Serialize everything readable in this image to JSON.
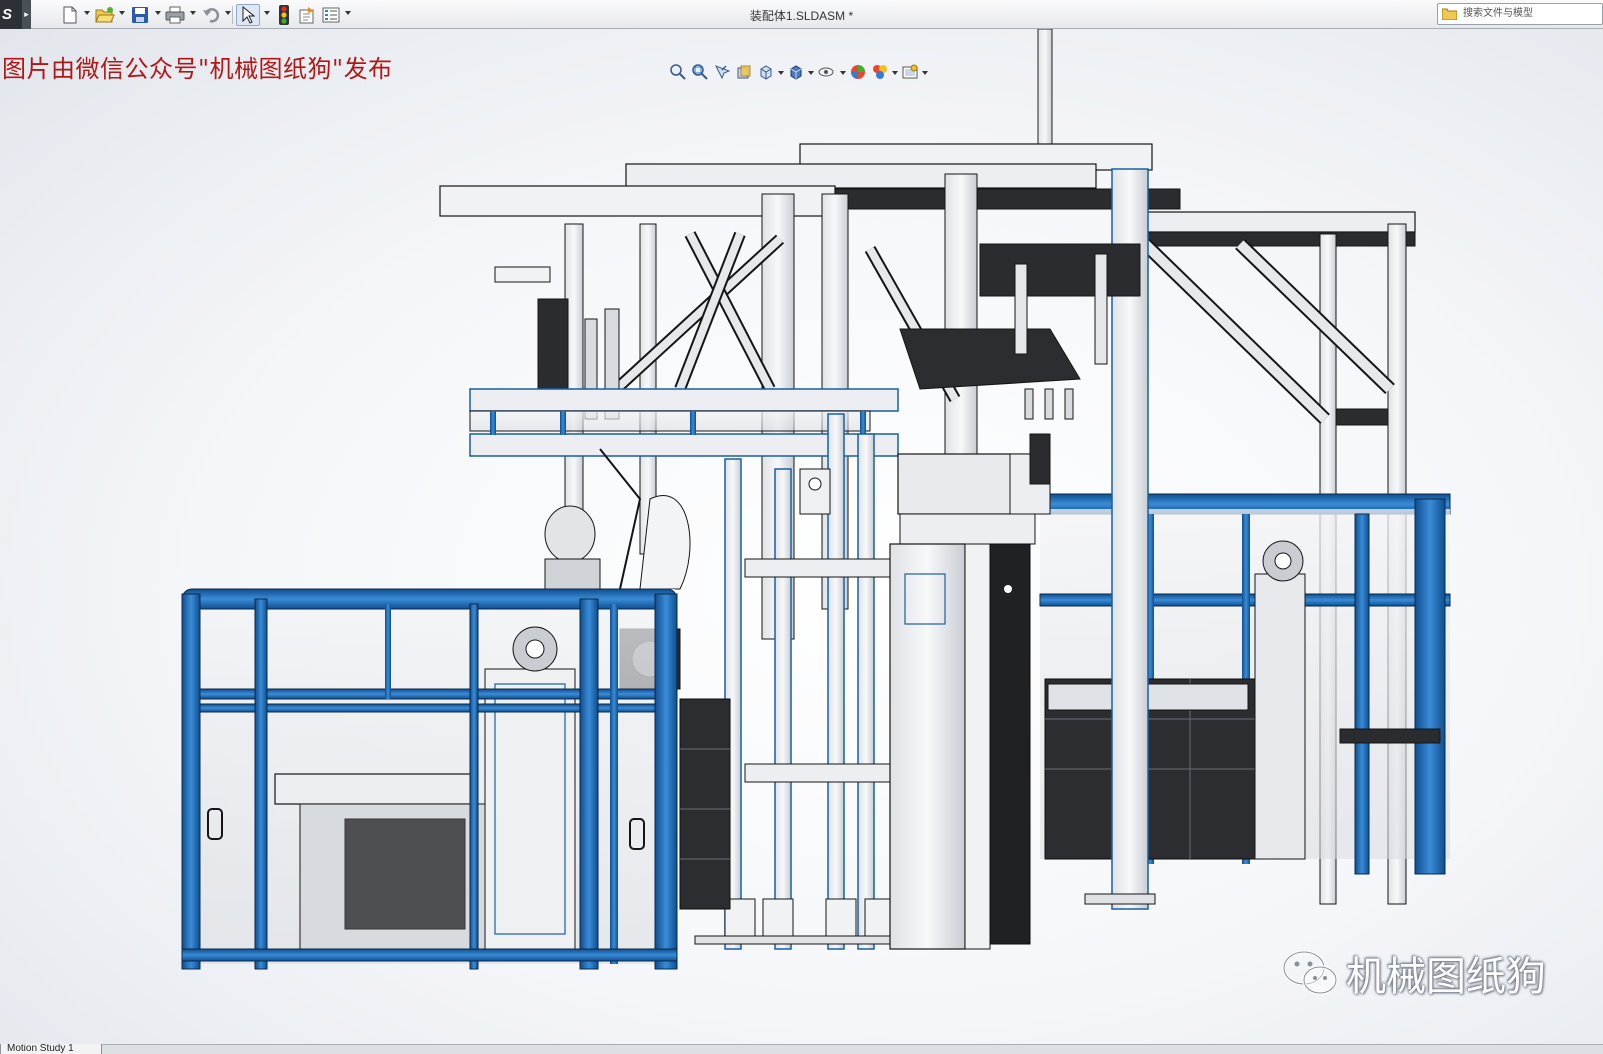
{
  "app": {
    "logo_text": "S"
  },
  "window": {
    "document_title": "装配体1.SLDASM *"
  },
  "search": {
    "placeholder": "搜索文件与模型"
  },
  "toolbar": {
    "icons": [
      "new-document-icon",
      "open-folder-icon",
      "save-icon",
      "print-icon",
      "undo-icon",
      "select-arrow-icon",
      "rebuild-traffic-light-icon",
      "file-properties-icon",
      "options-icon"
    ]
  },
  "view_toolbar": {
    "icons": [
      "zoom-to-fit-icon",
      "zoom-to-area-icon",
      "previous-view-icon",
      "section-view-icon",
      "view-orientation-icon",
      "display-style-icon",
      "hide-show-items-icon",
      "edit-appearance-icon",
      "apply-scene-icon",
      "view-settings-icon"
    ]
  },
  "viewport": {
    "watermark_top": "图片由微信公众号\"机械图纸狗\"发布",
    "watermark_brand": "机械图纸狗",
    "brand_icon": "wechat-icon"
  },
  "bottom_tabs": {
    "motion_study": "Motion Study 1"
  },
  "colors": {
    "frame_blue": "#1e6eb4",
    "frame_light": "#eef0f3",
    "frame_dark": "#26282c",
    "edge": "#151515",
    "watermark_red": "#b01818"
  }
}
